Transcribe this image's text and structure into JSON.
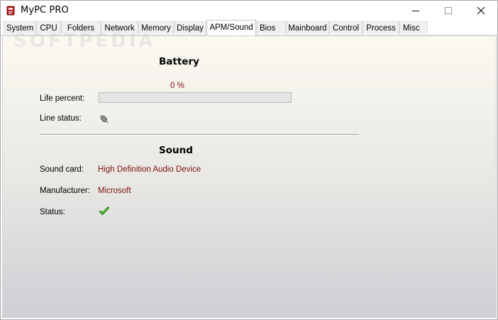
{
  "window": {
    "title": "MyPC PRO"
  },
  "tabs": [
    {
      "label": "System",
      "active": false
    },
    {
      "label": "CPU",
      "active": false
    },
    {
      "label": "Folders",
      "active": false
    },
    {
      "label": "Network",
      "active": false
    },
    {
      "label": "Memory",
      "active": false
    },
    {
      "label": "Display",
      "active": false
    },
    {
      "label": "APM/Sound",
      "active": true
    },
    {
      "label": "Bios",
      "active": false
    },
    {
      "label": "Mainboard",
      "active": false
    },
    {
      "label": "Control",
      "active": false
    },
    {
      "label": "Process",
      "active": false
    },
    {
      "label": "Misc",
      "active": false
    }
  ],
  "watermark": "SOFTPEDIA",
  "battery": {
    "title": "Battery",
    "percent_text": "0 %",
    "life_percent_value": 0,
    "life_percent_label": "Life percent:",
    "line_status_label": "Line status:",
    "line_status_icon": "power-plug-icon"
  },
  "sound": {
    "title": "Sound",
    "sound_card_label": "Sound card:",
    "sound_card_value": "High Definition Audio Device",
    "manufacturer_label": "Manufacturer:",
    "manufacturer_value": "Microsoft",
    "status_label": "Status:",
    "status_icon": "checkmark-icon"
  },
  "colors": {
    "value_text": "#7b1212",
    "status_ok": "#3fae29"
  }
}
